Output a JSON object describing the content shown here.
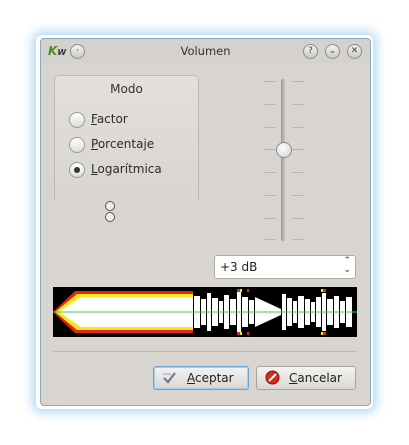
{
  "window": {
    "title": "Volumen"
  },
  "mode_group": {
    "title": "Modo",
    "options": [
      {
        "label": "Factor",
        "selected": false
      },
      {
        "label": "Porcentaje",
        "selected": false
      },
      {
        "label": "Logarítmica",
        "selected": true
      }
    ]
  },
  "volume": {
    "value": "+3 dB"
  },
  "buttons": {
    "ok": "Aceptar",
    "cancel": "Cancelar"
  },
  "colors": {
    "waveform_bg": "#000000",
    "clip_red": "#e8221c",
    "warn_yellow": "#f4e91a",
    "center_line": "#35d447"
  },
  "icons": {
    "app": "kwave-logo-icon",
    "ok": "checkmark-icon",
    "cancel": "cancel-icon"
  }
}
